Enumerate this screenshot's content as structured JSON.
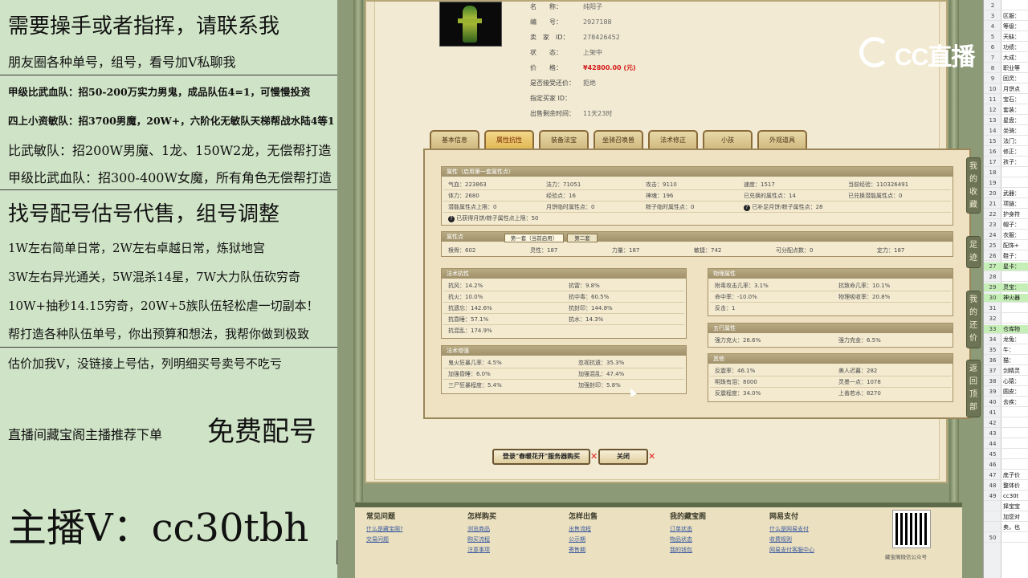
{
  "overlay": {
    "lines": [
      "需要操手或者指挥，请联系我",
      "朋友圈各种单号，组号，看号加V私聊我",
      "甲级比武血队：招50-200万实力男鬼，成品队伍4=1，可慢慢投资",
      "四上小资敏队：招3700男魔，20W+，六阶化无敏队天梯帮战水陆4等1",
      "比武敏队：招200W男魔、1龙、150W2龙，无偿帮打造",
      "甲级比武血队：招300-400W女魔，所有角色无偿帮打造",
      "找号配号估号代售，组号调整",
      "1W左右简单日常，2W左右卓越日常，炼狱地宫",
      "3W左右异光通关，5W混杀14星，7W大力队伍砍穷奇",
      "10W+抽秒14.15穷奇，20W+5族队伍轻松虐一切副本！",
      "帮打造各种队伍单号，你出预算和想法，我帮你做到极致",
      "估价加我V，没链接上号估，列明细买号卖号不吃亏",
      "直播间藏宝阁主播推荐下单",
      "免费配号",
      "主播V：cc30tbh"
    ]
  },
  "item_info": [
    {
      "label": "名　　称：",
      "value": "纯阳子"
    },
    {
      "label": "编　　号：",
      "value": "2927188"
    },
    {
      "label": "卖　家　ID：",
      "value": "278426452"
    },
    {
      "label": "状　　态：",
      "value": "上架中"
    },
    {
      "label": "价　　格：",
      "value": "¥42800.00 (元)"
    },
    {
      "label": "是否接受还价：",
      "value": "拒绝"
    },
    {
      "label": "指定买家 ID：",
      "value": ""
    },
    {
      "label": "出售剩余时间：",
      "value": "11天23时"
    }
  ],
  "tabs": [
    "基本信息",
    "属性抗性",
    "装备法宝",
    "坐骑召唤兽",
    "法术修正",
    "小孩",
    "外观道具"
  ],
  "active_tab": "属性抗性",
  "attr": {
    "title": "属性（启用第一套属性点）",
    "rows": [
      [
        "气血：223863",
        "法力：71051",
        "攻击：9110",
        "速度：1517",
        "当前经验：110326491"
      ],
      [
        "体力：2680",
        "经验点：16",
        "神魂：196",
        "已兑换的属性点：14",
        "已兑换潜能属性点：0"
      ],
      [
        "潜能属性点上限：0",
        "月饼临时属性点：0",
        "粽子临时属性点：0",
        "已补足月饼/粽子属性点：28",
        ""
      ]
    ],
    "note": "已获得月饼/粽子属性点上限：50"
  },
  "points": {
    "title": "属性点",
    "subtabs": [
      "第一套（当前启用）",
      "第二套"
    ],
    "row": [
      "根骨：602",
      "灵性：187",
      "力量：187",
      "敏捷：742",
      "可分配点数：0",
      "定力：187"
    ]
  },
  "spell_res": {
    "title": "法术抗性",
    "rows": [
      [
        "抗风：14.2%",
        "抗雷：9.8%"
      ],
      [
        "抗火：10.0%",
        "抗中毒：60.5%"
      ],
      [
        "抗遗忘：142.6%",
        "抗封印：144.8%"
      ],
      [
        "抗昏睡：57.1%",
        "抗水：14.3%"
      ],
      [
        "抗混乱：174.9%",
        ""
      ]
    ]
  },
  "spell_boost": {
    "title": "法术增强",
    "rows": [
      [
        "鬼火狂暴几率：4.5%",
        "忽视抗遗：35.3%"
      ],
      [
        "加强昏睡：6.0%",
        "加强混乱：47.4%"
      ],
      [
        "三尸狂暴程度：5.4%",
        "加强封印：5.8%"
      ]
    ]
  },
  "physical": {
    "title": "物理属性",
    "rows": [
      [
        "附毒攻击几率：3.1%",
        "抗致命几率：10.1%"
      ],
      [
        "命中率：-10.0%",
        "物理吸收率：20.8%"
      ],
      [
        "反击：1",
        ""
      ]
    ]
  },
  "wuxing": {
    "title": "五行属性",
    "rows": [
      [
        "强力克火：26.6%",
        "强力克金：6.5%"
      ]
    ]
  },
  "other": {
    "title": "其他",
    "rows": [
      [
        "反震率：46.1%",
        "美人迟暮：282"
      ],
      [
        "明珠有泪：8000",
        "灵墨一点：1078"
      ],
      [
        "反震程度：34.0%",
        "上善若水：8270"
      ]
    ]
  },
  "buttons": {
    "buy": "登录\"春暖花开\"服务器购买",
    "close": "关闭"
  },
  "side_buttons": [
    "我的收藏",
    "足迹",
    "我的还价",
    "返回顶部"
  ],
  "watermark": "CC直播",
  "footer": {
    "columns": [
      {
        "title": "常见问题",
        "links": [
          "什么是藏宝阁?",
          "交易问题",
          ""
        ]
      },
      {
        "title": "怎样购买",
        "links": [
          "浏览商品",
          "购买流程",
          "注意事项"
        ]
      },
      {
        "title": "怎样出售",
        "links": [
          "出售流程",
          "公示期",
          "寄售期"
        ]
      },
      {
        "title": "我的藏宝阁",
        "links": [
          "订单状态",
          "物品状态",
          "我的钱包"
        ]
      },
      {
        "title": "网易支付",
        "links": [
          "什么是网易支付",
          "收费规则",
          "网易支付客服中心"
        ]
      }
    ],
    "qr_caption": "藏宝阁微信公众号"
  },
  "sheet": {
    "rows": [
      {
        "n": "2",
        "t": ""
      },
      {
        "n": "3",
        "t": "区服："
      },
      {
        "n": "4",
        "t": "等级："
      },
      {
        "n": "5",
        "t": "天缺："
      },
      {
        "n": "6",
        "t": "功绩："
      },
      {
        "n": "7",
        "t": "大成："
      },
      {
        "n": "8",
        "t": "职业等"
      },
      {
        "n": "9",
        "t": "回灵："
      },
      {
        "n": "10",
        "t": "月饼点"
      },
      {
        "n": "11",
        "t": "宝石："
      },
      {
        "n": "12",
        "t": "套装："
      },
      {
        "n": "13",
        "t": "星盘："
      },
      {
        "n": "14",
        "t": "坐骑："
      },
      {
        "n": "15",
        "t": "法门："
      },
      {
        "n": "16",
        "t": "修正："
      },
      {
        "n": "17",
        "t": "孩子："
      },
      {
        "n": "18",
        "t": ""
      },
      {
        "n": "19",
        "t": ""
      },
      {
        "n": "20",
        "t": "武器："
      },
      {
        "n": "21",
        "t": "项链："
      },
      {
        "n": "22",
        "t": "护身符"
      },
      {
        "n": "23",
        "t": "帽子："
      },
      {
        "n": "24",
        "t": "衣服："
      },
      {
        "n": "25",
        "t": "配饰+"
      },
      {
        "n": "26",
        "t": "鞋子："
      },
      {
        "n": "27",
        "t": "星卡："
      },
      {
        "n": "28",
        "t": ""
      },
      {
        "n": "29",
        "t": "灵宝："
      },
      {
        "n": "30",
        "t": "神火器"
      },
      {
        "n": "31",
        "t": ""
      },
      {
        "n": "32",
        "t": ""
      },
      {
        "n": "33",
        "t": "仓库物"
      },
      {
        "n": "34",
        "t": "龙兔："
      },
      {
        "n": "35",
        "t": "牛："
      },
      {
        "n": "36",
        "t": "猫："
      },
      {
        "n": "37",
        "t": "剑精灵"
      },
      {
        "n": "38",
        "t": "心猿："
      },
      {
        "n": "39",
        "t": "圆皮："
      },
      {
        "n": "40",
        "t": "去疾："
      },
      {
        "n": "41",
        "t": ""
      },
      {
        "n": "42",
        "t": ""
      },
      {
        "n": "43",
        "t": ""
      },
      {
        "n": "44",
        "t": ""
      },
      {
        "n": "45",
        "t": ""
      },
      {
        "n": "46",
        "t": ""
      },
      {
        "n": "47",
        "t": "底子价"
      },
      {
        "n": "48",
        "t": "整体价"
      },
      {
        "n": "49",
        "t": "cc30t"
      },
      {
        "n": "",
        "t": "择宝宝"
      },
      {
        "n": "",
        "t": "加您对"
      },
      {
        "n": "",
        "t": "卖，也"
      },
      {
        "n": "50",
        "t": ""
      }
    ],
    "highlight": [
      "27",
      "29",
      "30",
      "33"
    ]
  }
}
